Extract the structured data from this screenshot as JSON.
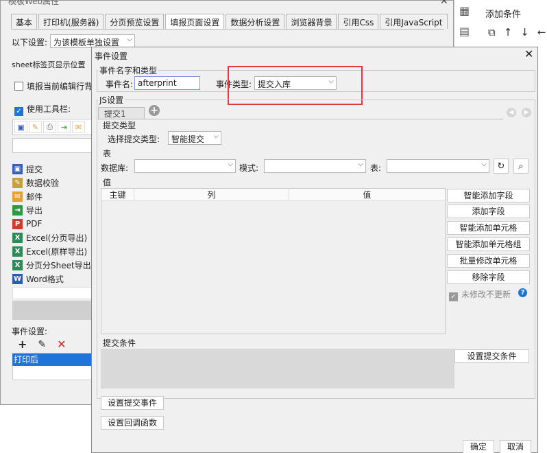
{
  "background_window": {
    "title": "模板Web属性",
    "tabs": [
      "基本",
      "打印机(服务器)",
      "分页预览设置",
      "填报页面设置",
      "数据分析设置",
      "浏览器背景",
      "引用Css",
      "引用JavaScript"
    ],
    "active_tab_index": 3,
    "setting_label": "以下设置:",
    "setting_value": "为该模板单独设置",
    "sheet_label": "sheet标签页显示位置",
    "fill_row_label": "填报当前编辑行背",
    "use_toolbar_label": "使用工具栏:",
    "toolbar_buttons": [
      {
        "icon": "save-icon",
        "label": "提交",
        "color": "#3a5fb3"
      },
      {
        "icon": "verify-icon",
        "label": "数据校验",
        "color": "#c8a040"
      },
      {
        "icon": "mail-icon",
        "label": "邮件",
        "color": "#e8a030"
      },
      {
        "icon": "export-icon",
        "label": "导出",
        "color": "#2e9a3e"
      },
      {
        "icon": "pdf-icon",
        "label": "PDF",
        "color": "#d23a2a"
      },
      {
        "icon": "excel-icon",
        "label": "Excel(分页导出)",
        "color": "#2e8b57"
      },
      {
        "icon": "excel-icon",
        "label": "Excel(原样导出)",
        "color": "#2e8b57"
      },
      {
        "icon": "excel-icon",
        "label": "分页分Sheet导出",
        "color": "#2e8b57"
      },
      {
        "icon": "word-icon",
        "label": "Word格式",
        "color": "#2a5bb8"
      }
    ],
    "event_settings_label": "事件设置:",
    "event_selected": "打印后"
  },
  "right_panel": {
    "title": "添加条件"
  },
  "dialog": {
    "title": "事件设置",
    "name_group_label": "事件名字和类型",
    "event_name_label": "事件名:",
    "event_name_value": "afterprint",
    "event_type_label": "事件类型:",
    "event_type_value": "提交入库",
    "js_group_label": "JS设置",
    "sub_tab": "提交1",
    "submit_type_label": "提交类型",
    "choose_submit_type_label": "选择提交类型:",
    "submit_type_value": "智能提交",
    "table_section_label": "表",
    "database_label": "数据库:",
    "schema_label": "模式:",
    "table_label": "表:",
    "value_section_label": "值",
    "columns": [
      "主键",
      "列",
      "值"
    ],
    "side_buttons": [
      "智能添加字段",
      "添加字段",
      "智能添加单元格",
      "智能添加单元格组",
      "批量修改单元格",
      "移除字段"
    ],
    "unchanged_label": "未修改不更新",
    "submit_condition_label": "提交条件",
    "set_condition_button": "设置提交条件",
    "set_submit_event_button": "设置提交事件",
    "set_callback_button": "设置回调函数",
    "ok_button": "确定",
    "cancel_button": "取消"
  }
}
